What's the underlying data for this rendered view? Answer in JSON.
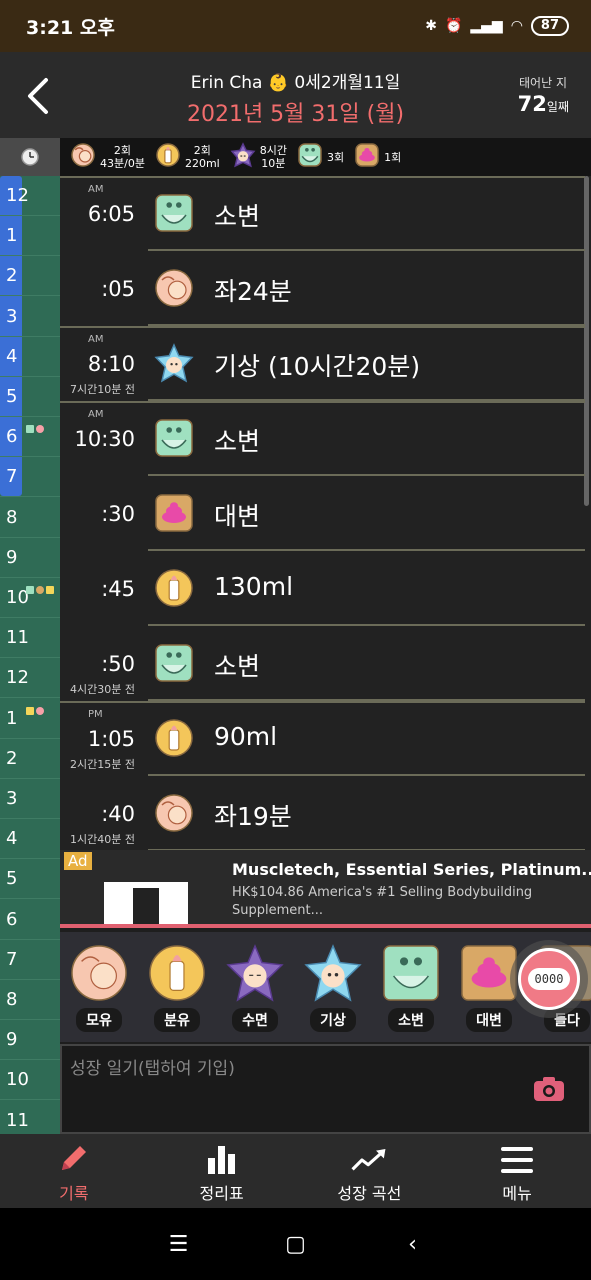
{
  "status_bar": {
    "time": "3:21 오후",
    "battery": "87"
  },
  "header": {
    "name": "Erin Cha",
    "age_months": "0세2개월11일",
    "date": "2021년 5월 31일 (월)",
    "age_label": "태어난 지",
    "age_days": "72",
    "age_days_unit": "일째"
  },
  "summary": [
    {
      "icon": "breastfeed-icon",
      "line1": "2회",
      "line2": "43분/0분"
    },
    {
      "icon": "bottle-icon",
      "line1": "2회",
      "line2": "220ml"
    },
    {
      "icon": "sleep-icon",
      "line1": "8시간",
      "line2": "10분"
    },
    {
      "icon": "pee-icon",
      "line1": "3회",
      "line2": ""
    },
    {
      "icon": "poop-icon",
      "line1": "1회",
      "line2": ""
    }
  ],
  "timeline_hours": [
    "12",
    "1",
    "2",
    "3",
    "4",
    "5",
    "6",
    "7",
    "8",
    "9",
    "10",
    "11",
    "12",
    "1",
    "2",
    "3",
    "4",
    "5",
    "6",
    "7",
    "8",
    "9",
    "10",
    "11"
  ],
  "entries": [
    {
      "ampm": "AM",
      "time": "6:05",
      "elapsed": "",
      "icon": "pee-icon",
      "label": "소변"
    },
    {
      "ampm": "",
      "time": ":05",
      "elapsed": "",
      "icon": "breastfeed-icon",
      "label": "좌24분"
    },
    {
      "ampm": "AM",
      "time": "8:10",
      "elapsed": "7시간10분 전",
      "icon": "wake-icon",
      "label": "기상 (10시간20분)"
    },
    {
      "ampm": "AM",
      "time": "10:30",
      "elapsed": "",
      "icon": "pee-icon",
      "label": "소변"
    },
    {
      "ampm": "",
      "time": ":30",
      "elapsed": "",
      "icon": "poop-icon",
      "label": "대변"
    },
    {
      "ampm": "",
      "time": ":45",
      "elapsed": "",
      "icon": "bottle-icon",
      "label": "130ml"
    },
    {
      "ampm": "",
      "time": ":50",
      "elapsed": "4시간30분 전",
      "icon": "pee-icon",
      "label": "소변"
    },
    {
      "ampm": "PM",
      "time": "1:05",
      "elapsed": "2시간15분 전",
      "icon": "bottle-icon",
      "label": "90ml"
    },
    {
      "ampm": "",
      "time": ":40",
      "elapsed": "1시간40분 전",
      "icon": "breastfeed-icon",
      "label": "좌19분"
    }
  ],
  "ad": {
    "badge": "Ad",
    "title": "Muscletech, Essential Series, Platinum...",
    "desc": "HK$104.86 America's #1 Selling Bodybuilding Supplement..."
  },
  "quick_actions": [
    {
      "label": "모유",
      "icon": "breastfeed-icon"
    },
    {
      "label": "분유",
      "icon": "bottle-icon"
    },
    {
      "label": "수면",
      "icon": "sleep-icon"
    },
    {
      "label": "기상",
      "icon": "wake-icon"
    },
    {
      "label": "소변",
      "icon": "pee-icon"
    },
    {
      "label": "대변",
      "icon": "poop-icon"
    },
    {
      "label": "들다",
      "icon": "more-icon"
    }
  ],
  "timer": {
    "display": "0000"
  },
  "diary": {
    "placeholder": "성장 일기(탭하여 기입)"
  },
  "bottom_nav": [
    {
      "label": "기록",
      "icon": "pencil-icon",
      "active": true
    },
    {
      "label": "정리표",
      "icon": "bar-chart-icon",
      "active": false
    },
    {
      "label": "성장 곡선",
      "icon": "trend-icon",
      "active": false
    },
    {
      "label": "메뉴",
      "icon": "menu-icon",
      "active": false
    }
  ],
  "colors": {
    "accent": "#f26d6d",
    "timeline": "#2f6b55",
    "sleep_band": "#3b6fd6"
  }
}
